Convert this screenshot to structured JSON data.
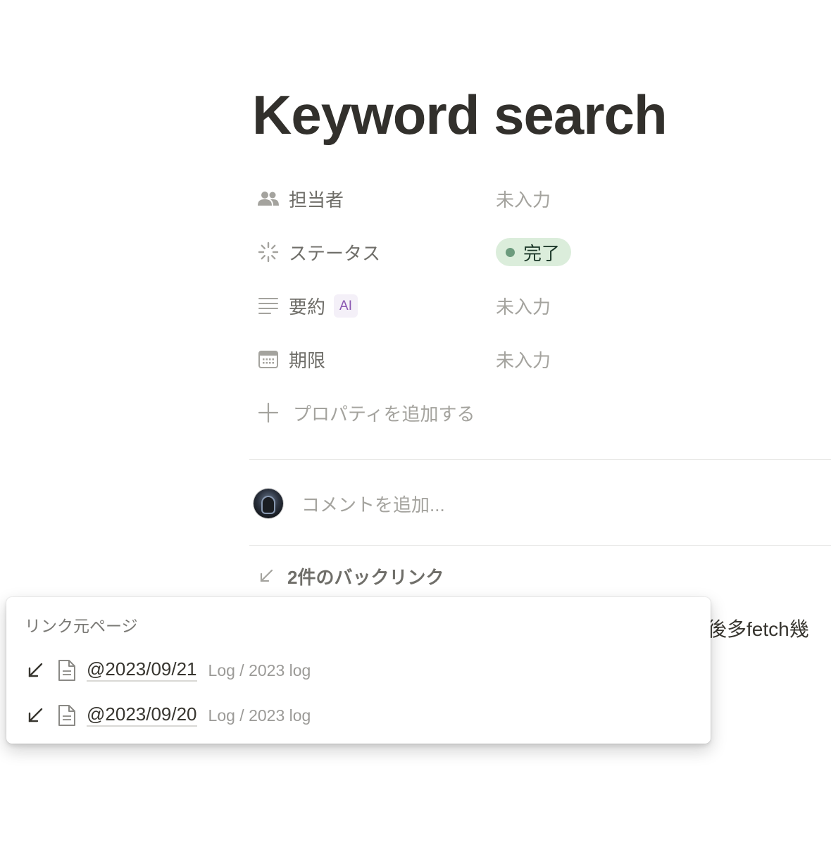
{
  "page": {
    "title": "Keyword search"
  },
  "properties": [
    {
      "icon": "people-icon",
      "key": "担当者",
      "value": "未入力"
    },
    {
      "icon": "status-icon",
      "key": "ステータス",
      "value": "完了",
      "value_color": "#dbeddb",
      "dot_color": "#6c9b7d"
    },
    {
      "icon": "text-lines-icon",
      "key": "要約",
      "badge": "AI",
      "value": "未入力"
    },
    {
      "icon": "calendar-icon",
      "key": "期限",
      "value": "未入力"
    }
  ],
  "add_property": {
    "icon": "plus-icon",
    "label": "プロパティを追加する"
  },
  "comment": {
    "placeholder": "コメントを追加..."
  },
  "backlinks": {
    "icon": "arrow-down-left-icon",
    "label": "2件のバックリンク"
  },
  "body_partial_text": "後多fetch幾",
  "popup": {
    "header": "リンク元ページ",
    "items": [
      {
        "title": "@2023/09/21",
        "path": "Log / 2023 log"
      },
      {
        "title": "@2023/09/20",
        "path": "Log / 2023 log"
      }
    ]
  },
  "colors": {
    "text": "#37352f",
    "muted": "#a4a39e",
    "status_bg": "#dbeddb",
    "ai_badge": "#8a57b2"
  }
}
